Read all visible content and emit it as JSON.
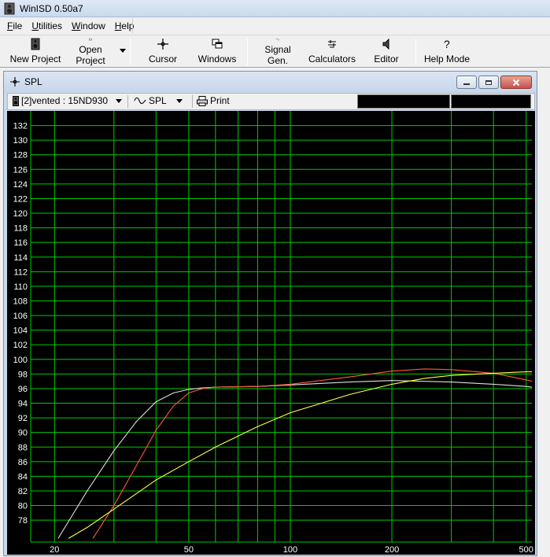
{
  "window": {
    "title": "WinISD 0.50a7"
  },
  "menu": [
    {
      "label": "File",
      "accel": "F"
    },
    {
      "label": "Utilities",
      "accel": "U"
    },
    {
      "label": "Window",
      "accel": "W"
    },
    {
      "label": "Help",
      "accel": "H"
    }
  ],
  "toolbar": {
    "new_project": "New Project",
    "open_project": "Open Project",
    "cursor": "Cursor",
    "windows": "Windows",
    "signal_gen": "Signal Gen.",
    "calculators": "Calculators",
    "editor": "Editor",
    "help_mode": "Help Mode"
  },
  "child": {
    "title": "SPL",
    "project_selector": "[2]vented : 15ND930",
    "graph_selector": "SPL",
    "print_label": "Print"
  },
  "chart_data": {
    "type": "line",
    "x_scale": "log",
    "xlim": [
      17,
      520
    ],
    "ylim": [
      75,
      134
    ],
    "grid": true,
    "grid_color": "#00cc00",
    "background": "#000000",
    "x_ticks": [
      {
        "value": 20,
        "label": "20"
      },
      {
        "value": 50,
        "label": "50"
      },
      {
        "value": 100,
        "label": "100"
      },
      {
        "value": 200,
        "label": "200"
      },
      {
        "value": 500,
        "label": "500"
      }
    ],
    "x_grid": [
      20,
      30,
      40,
      50,
      60,
      70,
      80,
      90,
      100,
      200,
      300,
      400,
      500
    ],
    "y_ticks": [
      78,
      80,
      82,
      84,
      86,
      88,
      90,
      92,
      94,
      96,
      98,
      100,
      102,
      104,
      106,
      108,
      110,
      112,
      114,
      116,
      118,
      120,
      122,
      124,
      126,
      128,
      130,
      132
    ],
    "series": [
      {
        "color": "#e0e0e0",
        "x": [
          20.5,
          25,
          30,
          35,
          40,
          45,
          50,
          55,
          60,
          80,
          100,
          150,
          200,
          250,
          300,
          400,
          500,
          520
        ],
        "y": [
          75.5,
          82,
          87.5,
          91.5,
          94.2,
          95.4,
          95.9,
          96.1,
          96.2,
          96.3,
          96.5,
          96.9,
          97.1,
          97.0,
          96.9,
          96.6,
          96.3,
          96.2
        ]
      },
      {
        "color": "#ff5a3c",
        "x": [
          26,
          30,
          35,
          40,
          45,
          50,
          55,
          60,
          80,
          100,
          150,
          200,
          250,
          300,
          400,
          500,
          520
        ],
        "y": [
          75.5,
          80,
          85.5,
          90.3,
          93.6,
          95.4,
          96.0,
          96.2,
          96.3,
          96.6,
          97.6,
          98.4,
          98.7,
          98.6,
          98.1,
          97.2,
          97.0
        ]
      },
      {
        "color": "#ffff40",
        "x": [
          22,
          25,
          30,
          40,
          50,
          60,
          80,
          100,
          150,
          200,
          250,
          300,
          400,
          500,
          520
        ],
        "y": [
          75.5,
          77,
          79.5,
          83.5,
          86.0,
          88.0,
          90.8,
          92.7,
          95.2,
          96.6,
          97.4,
          97.8,
          98.1,
          98.3,
          98.3
        ]
      }
    ]
  }
}
